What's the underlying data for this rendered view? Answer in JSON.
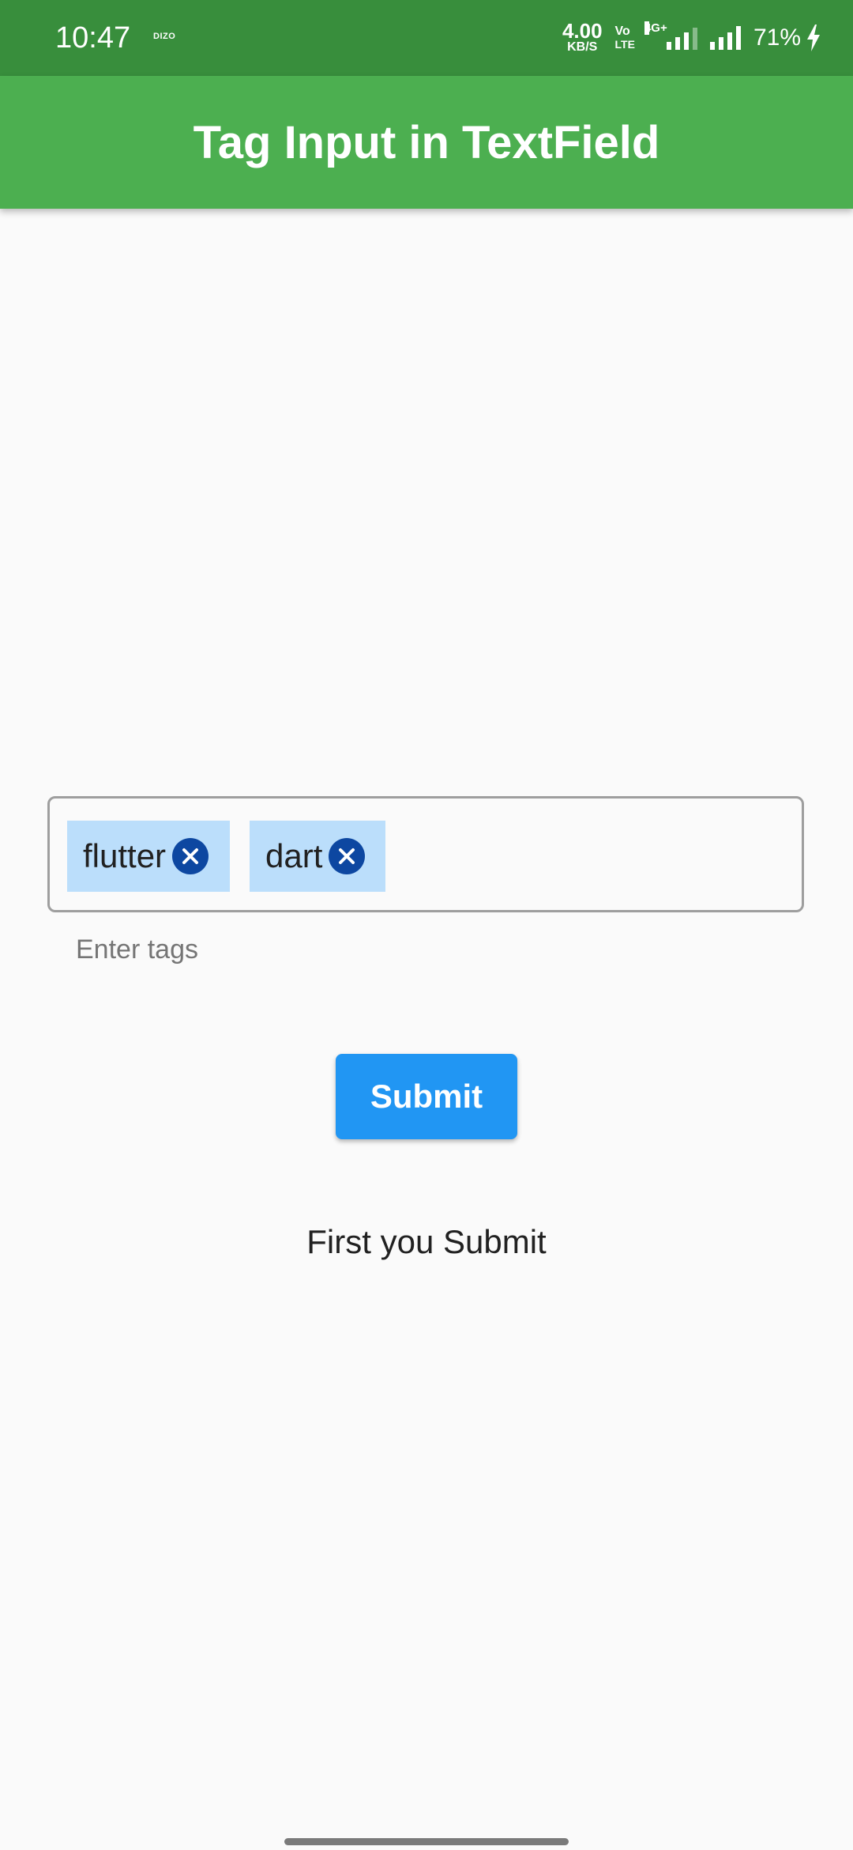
{
  "status_bar": {
    "time": "10:47",
    "carrier": "DIZO",
    "net_speed_value": "4.00",
    "net_speed_unit": "KB/S",
    "volte_top": "Vo",
    "volte_bottom": "LTE",
    "network_type": "4G+",
    "battery": "71%"
  },
  "app_bar": {
    "title": "Tag Input in TextField"
  },
  "tag_field": {
    "tags": [
      {
        "label": "flutter"
      },
      {
        "label": "dart"
      }
    ],
    "helper_text": "Enter tags"
  },
  "submit_button": {
    "label": "Submit"
  },
  "result_text": "First you Submit",
  "colors": {
    "status_bar": "#388e3c",
    "app_bar": "#4caf50",
    "chip_bg": "#bbdefb",
    "chip_icon": "#0d47a1",
    "button": "#2196f3"
  }
}
